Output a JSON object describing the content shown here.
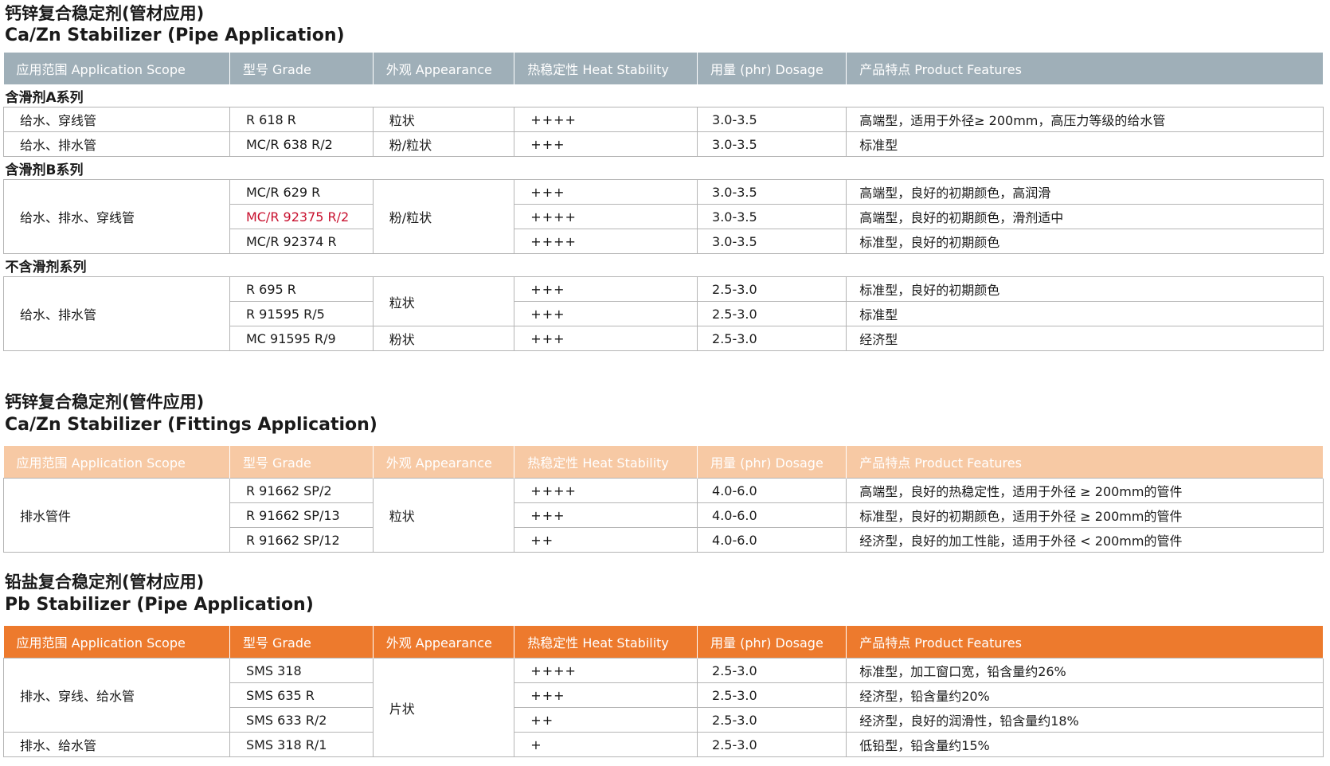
{
  "headers": [
    "应用范围 Application Scope",
    "型号 Grade",
    "外观 Appearance",
    "热稳定性 Heat Stability",
    "用量 (phr) Dosage",
    "产品特点 Product Features"
  ],
  "headers_t2": [
    "应用范围  Application Scope",
    "型号 Grade",
    "外观 Appearance",
    "热稳定性 Heat Stability",
    "用量 (phr) Dosage",
    "产品特点 Product Features"
  ],
  "colors": {
    "header1": "#9fafb8",
    "header2": "#f7c9a4",
    "header3": "#ed7a2d",
    "highlight": "#c8102e"
  },
  "s1": {
    "title_zh": "钙锌复合稳定剂(管材应用)",
    "title_en": "Ca/Zn Stabilizer (Pipe Application)",
    "groupA": {
      "label": "含滑剂A系列",
      "rows": [
        {
          "scope": "给水、穿线管",
          "grade": "R 618 R",
          "appearance": "粒状",
          "heat": "++++",
          "dosage": "3.0-3.5",
          "features": "高端型，适用于外径≥ 200mm，高压力等级的给水管"
        },
        {
          "scope": "给水、排水管",
          "grade": "MC/R 638 R/2",
          "appearance": "粉/粒状",
          "heat": "+++",
          "dosage": "3.0-3.5",
          "features": "标准型"
        }
      ]
    },
    "groupB": {
      "label": "含滑剂B系列",
      "scope": "给水、排水、穿线管",
      "appearance": "粉/粒状",
      "rows": [
        {
          "grade": "MC/R 629 R",
          "heat": "+++",
          "dosage": "3.0-3.5",
          "features": "高端型，良好的初期颜色，高润滑"
        },
        {
          "grade": "MC/R 92375 R/2",
          "heat": "++++",
          "dosage": "3.0-3.5",
          "features": "高端型，良好的初期颜色，滑剂适中"
        },
        {
          "grade": "MC/R 92374 R",
          "heat": "++++",
          "dosage": "3.0-3.5",
          "features": "标准型，良好的初期颜色"
        }
      ]
    },
    "groupC": {
      "label": "不含滑剂系列",
      "scope": "给水、排水管",
      "appearance1": "粒状",
      "appearance2": "粉状",
      "rows": [
        {
          "grade": "R 695 R",
          "heat": "+++",
          "dosage": "2.5-3.0",
          "features": "标准型，良好的初期颜色"
        },
        {
          "grade": "R 91595 R/5",
          "heat": "+++",
          "dosage": "2.5-3.0",
          "features": "标准型"
        },
        {
          "grade": "MC 91595 R/9",
          "heat": "+++",
          "dosage": "2.5-3.0",
          "features": "经济型"
        }
      ]
    }
  },
  "s2": {
    "title_zh": "钙锌复合稳定剂(管件应用)",
    "title_en": "Ca/Zn Stabilizer (Fittings Application)",
    "scope": "排水管件",
    "appearance": "粒状",
    "rows": [
      {
        "grade": "R 91662 SP/2",
        "heat": "++++",
        "dosage": "4.0-6.0",
        "features": "高端型，良好的热稳定性，适用于外径  ≥ 200mm的管件"
      },
      {
        "grade": "R 91662 SP/13",
        "heat": "+++",
        "dosage": "4.0-6.0",
        "features": "标准型，良好的初期颜色，适用于外径  ≥ 200mm的管件"
      },
      {
        "grade": "R 91662 SP/12",
        "heat": "++",
        "dosage": "4.0-6.0",
        "features": "经济型，良好的加工性能，适用于外径 < 200mm的管件"
      }
    ]
  },
  "s3": {
    "title_zh": "铅盐复合稳定剂(管材应用)",
    "title_en": "Pb Stabilizer (Pipe Application)",
    "scope1": "排水、穿线、给水管",
    "scope2": "排水、给水管",
    "appearance": "片状",
    "rows": [
      {
        "grade": "SMS 318",
        "heat": "++++",
        "dosage": "2.5-3.0",
        "features": "标准型，加工窗口宽，铅含量约26%"
      },
      {
        "grade": "SMS 635 R",
        "heat": "+++",
        "dosage": "2.5-3.0",
        "features": "经济型，铅含量约20%"
      },
      {
        "grade": "SMS 633 R/2",
        "heat": "++",
        "dosage": "2.5-3.0",
        "features": "经济型，良好的润滑性，铅含量约18%"
      },
      {
        "grade": "SMS 318 R/1",
        "heat": "+",
        "dosage": "2.5-3.0",
        "features": "低铅型，铅含量约15%"
      }
    ]
  }
}
